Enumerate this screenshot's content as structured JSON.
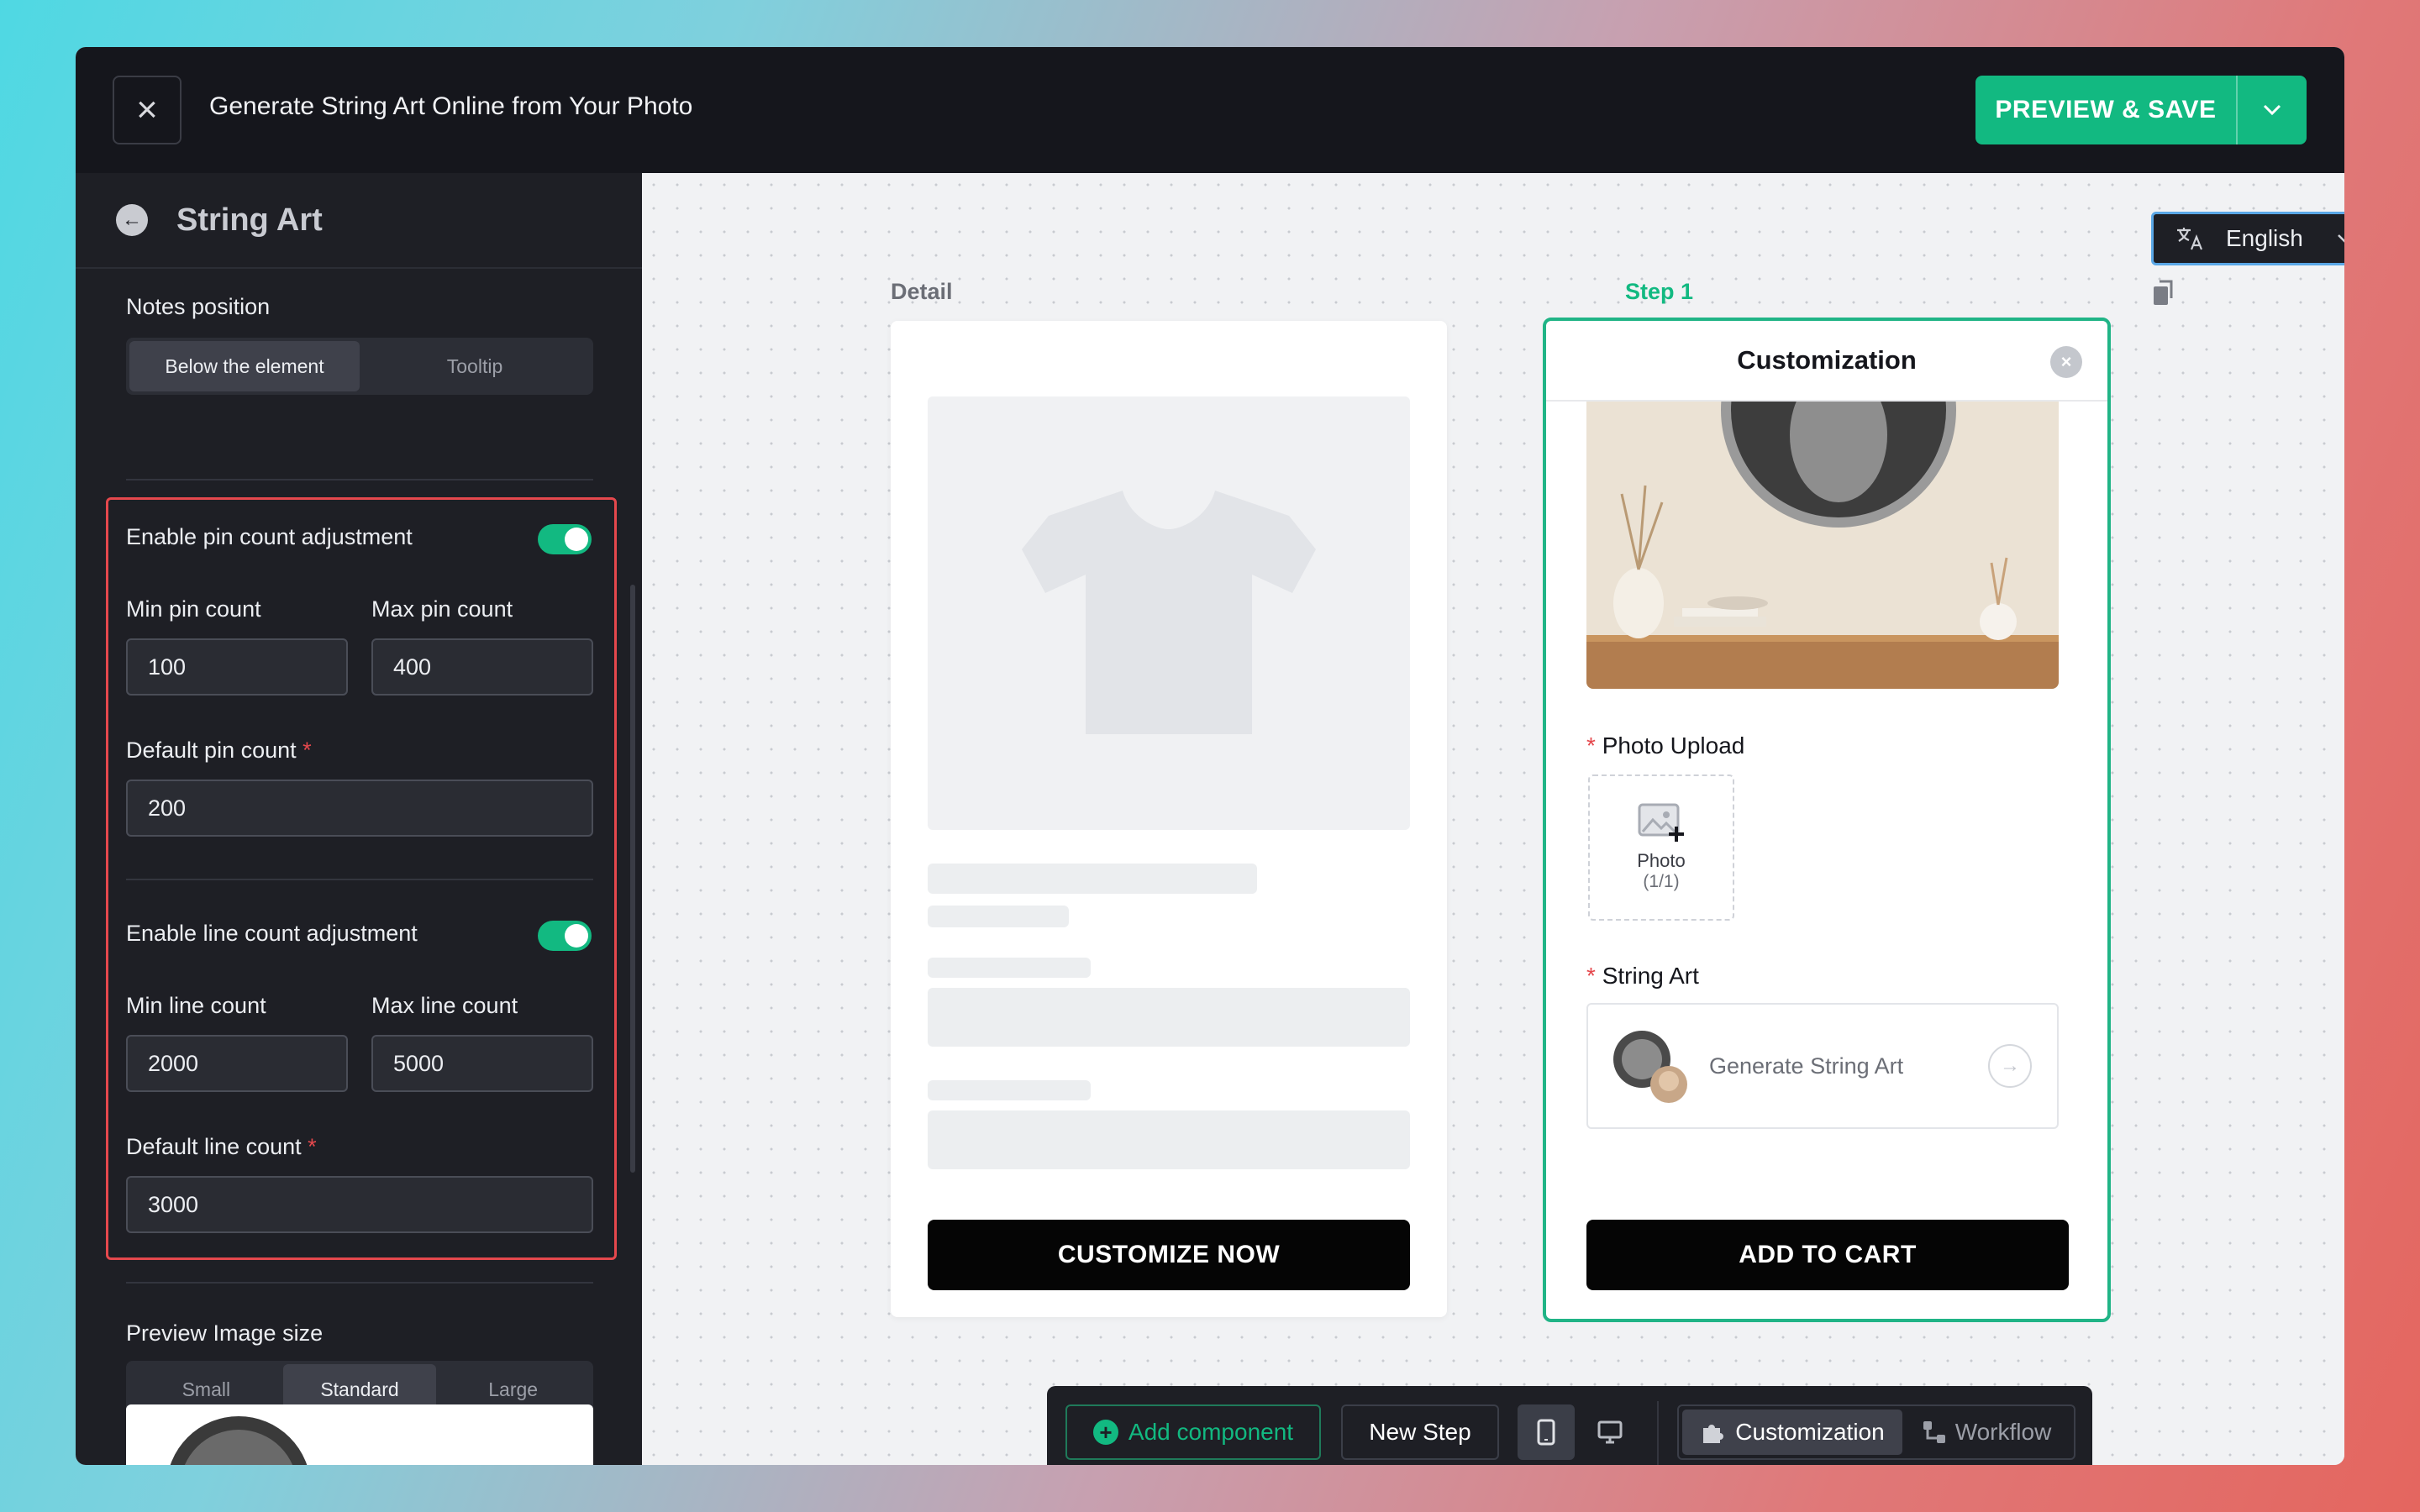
{
  "header": {
    "title": "Generate String Art Online from Your Photo",
    "save_label": "PREVIEW & SAVE"
  },
  "sidebar": {
    "title": "String Art",
    "notes_position": {
      "label": "Notes position",
      "options": [
        "Below the element",
        "Tooltip"
      ],
      "selected": "Below the element"
    },
    "pin": {
      "toggle_label": "Enable pin count adjustment",
      "min_label": "Min pin count",
      "min_value": "100",
      "max_label": "Max pin count",
      "max_value": "400",
      "default_label": "Default pin count",
      "default_value": "200"
    },
    "line": {
      "toggle_label": "Enable line count adjustment",
      "min_label": "Min line count",
      "min_value": "2000",
      "max_label": "Max line count",
      "max_value": "5000",
      "default_label": "Default line count",
      "default_value": "3000"
    },
    "preview_size": {
      "label": "Preview Image size",
      "options": [
        "Small",
        "Standard",
        "Large"
      ],
      "selected": "Standard"
    },
    "required_mark": "*"
  },
  "canvas": {
    "language": "English",
    "detail_label": "Detail",
    "step_label": "Step 1",
    "customize_now": "CUSTOMIZE NOW",
    "customization_title": "Customization",
    "photo_upload_label": "Photo Upload",
    "photo_tile_label": "Photo",
    "photo_tile_count": "(1/1)",
    "string_art_label": "String Art",
    "generate_label": "Generate String Art",
    "add_to_cart": "ADD TO CART"
  },
  "toolbar": {
    "add_component": "Add component",
    "new_step": "New Step",
    "customization": "Customization",
    "workflow": "Workflow"
  },
  "colors": {
    "accent": "#12b981",
    "error": "#e5484d",
    "step_border": "#20b486"
  }
}
